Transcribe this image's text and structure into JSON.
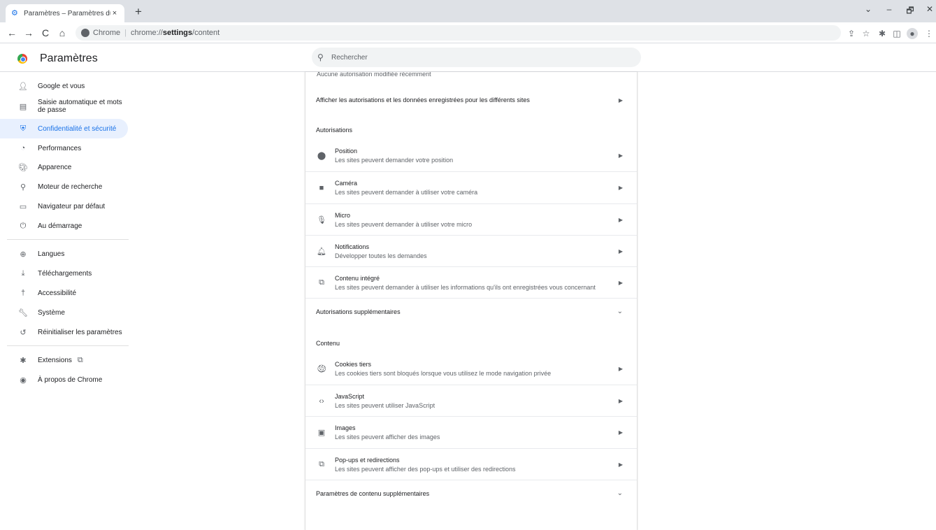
{
  "tab": {
    "title": "Paramètres – Paramètres du site",
    "close": "×",
    "newtab": "+"
  },
  "window_controls": {
    "dropdown": "⌄",
    "minimize": "–",
    "restore": "🗗",
    "close": "✕"
  },
  "toolbar": {
    "back": "←",
    "forward": "→",
    "reload": "C",
    "home": "⌂",
    "site_label": "Chrome",
    "url_prefix": "chrome://",
    "url_main": "settings",
    "url_suffix": "/content"
  },
  "header": {
    "title": "Paramètres",
    "search_placeholder": "Rechercher"
  },
  "sidebar": {
    "items": [
      {
        "label": "Google et vous",
        "icon": "person-icon"
      },
      {
        "label": "Saisie automatique et mots de passe",
        "icon": "clipboard-icon"
      },
      {
        "label": "Confidentialité et sécurité",
        "icon": "shield-icon",
        "active": true
      },
      {
        "label": "Performances",
        "icon": "speedometer-icon"
      },
      {
        "label": "Apparence",
        "icon": "palette-icon"
      },
      {
        "label": "Moteur de recherche",
        "icon": "search-icon"
      },
      {
        "label": "Navigateur par défaut",
        "icon": "browser-icon"
      },
      {
        "label": "Au démarrage",
        "icon": "power-icon"
      },
      {
        "label": "Langues",
        "icon": "globe-icon"
      },
      {
        "label": "Téléchargements",
        "icon": "download-icon"
      },
      {
        "label": "Accessibilité",
        "icon": "accessibility-icon"
      },
      {
        "label": "Système",
        "icon": "wrench-icon"
      },
      {
        "label": "Réinitialiser les paramètres",
        "icon": "reset-icon"
      },
      {
        "label": "Extensions",
        "icon": "puzzle-icon"
      },
      {
        "label": "À propos de Chrome",
        "icon": "chrome-icon"
      }
    ]
  },
  "main": {
    "recent_note": "Aucune autorisation modifiée récemment",
    "all_sites_row": "Afficher les autorisations et les données enregistrées pour les différents sites",
    "permissions_heading": "Autorisations",
    "permissions": [
      {
        "title": "Position",
        "desc": "Les sites peuvent demander votre position"
      },
      {
        "title": "Caméra",
        "desc": "Les sites peuvent demander à utiliser votre caméra"
      },
      {
        "title": "Micro",
        "desc": "Les sites peuvent demander à utiliser votre micro"
      },
      {
        "title": "Notifications",
        "desc": "Développer toutes les demandes"
      },
      {
        "title": "Contenu intégré",
        "desc": "Les sites peuvent demander à utiliser les informations qu'ils ont enregistrées vous concernant"
      }
    ],
    "additional_permissions": "Autorisations supplémentaires",
    "content_heading": "Contenu",
    "content": [
      {
        "title": "Cookies tiers",
        "desc": "Les cookies tiers sont bloqués lorsque vous utilisez le mode navigation privée"
      },
      {
        "title": "JavaScript",
        "desc": "Les sites peuvent utiliser JavaScript"
      },
      {
        "title": "Images",
        "desc": "Les sites peuvent afficher des images"
      },
      {
        "title": "Pop-ups et redirections",
        "desc": "Les sites peuvent afficher des pop-ups et utiliser des redirections"
      }
    ],
    "additional_content": "Paramètres de contenu supplémentaires"
  },
  "colors": {
    "accent": "#1a73e8",
    "active_bg": "#e8f0fe",
    "tabstrip": "#dee1e6"
  }
}
